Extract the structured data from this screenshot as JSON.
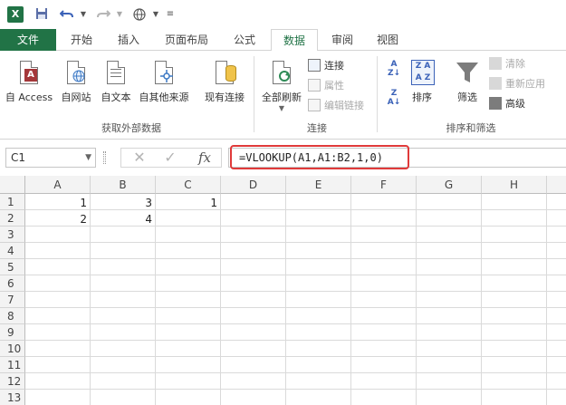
{
  "qat": {
    "excel_icon": "X",
    "save_icon": "save-icon",
    "undo_icon": "undo-icon",
    "redo_icon": "redo-icon",
    "customize_icon": "customize-icon"
  },
  "tabs": {
    "file": "文件",
    "items": [
      "开始",
      "插入",
      "页面布局",
      "公式",
      "数据",
      "审阅",
      "视图"
    ],
    "active": "数据"
  },
  "ribbon": {
    "get_external": {
      "buttons": [
        "自 Access",
        "自网站",
        "自文本",
        "自其他来源",
        "现有连接"
      ],
      "label": "获取外部数据"
    },
    "connections": {
      "refresh_all": "全部刷新",
      "connections": "连接",
      "properties": "属性",
      "edit_links": "编辑链接",
      "label": "连接"
    },
    "sort_filter": {
      "sort": "排序",
      "filter": "筛选",
      "clear": "清除",
      "reapply": "重新应用",
      "advanced": "高级",
      "label": "排序和筛选"
    }
  },
  "formula_bar": {
    "name_box": "C1",
    "cancel_icon": "✕",
    "enter_icon": "✓",
    "fx_label": "fx",
    "formula": "=VLOOKUP(A1,A1:B2,1,0)"
  },
  "sheet": {
    "columns": [
      "A",
      "B",
      "C",
      "D",
      "E",
      "F",
      "G",
      "H"
    ],
    "rows": [
      "1",
      "2",
      "3",
      "4",
      "5",
      "6",
      "7",
      "8",
      "9",
      "10",
      "11",
      "12",
      "13"
    ],
    "cells": {
      "A1": "1",
      "B1": "3",
      "C1": "1",
      "A2": "2",
      "B2": "4"
    },
    "selected": "C1"
  },
  "colors": {
    "accent": "#217346",
    "highlight": "#e03a3a"
  }
}
